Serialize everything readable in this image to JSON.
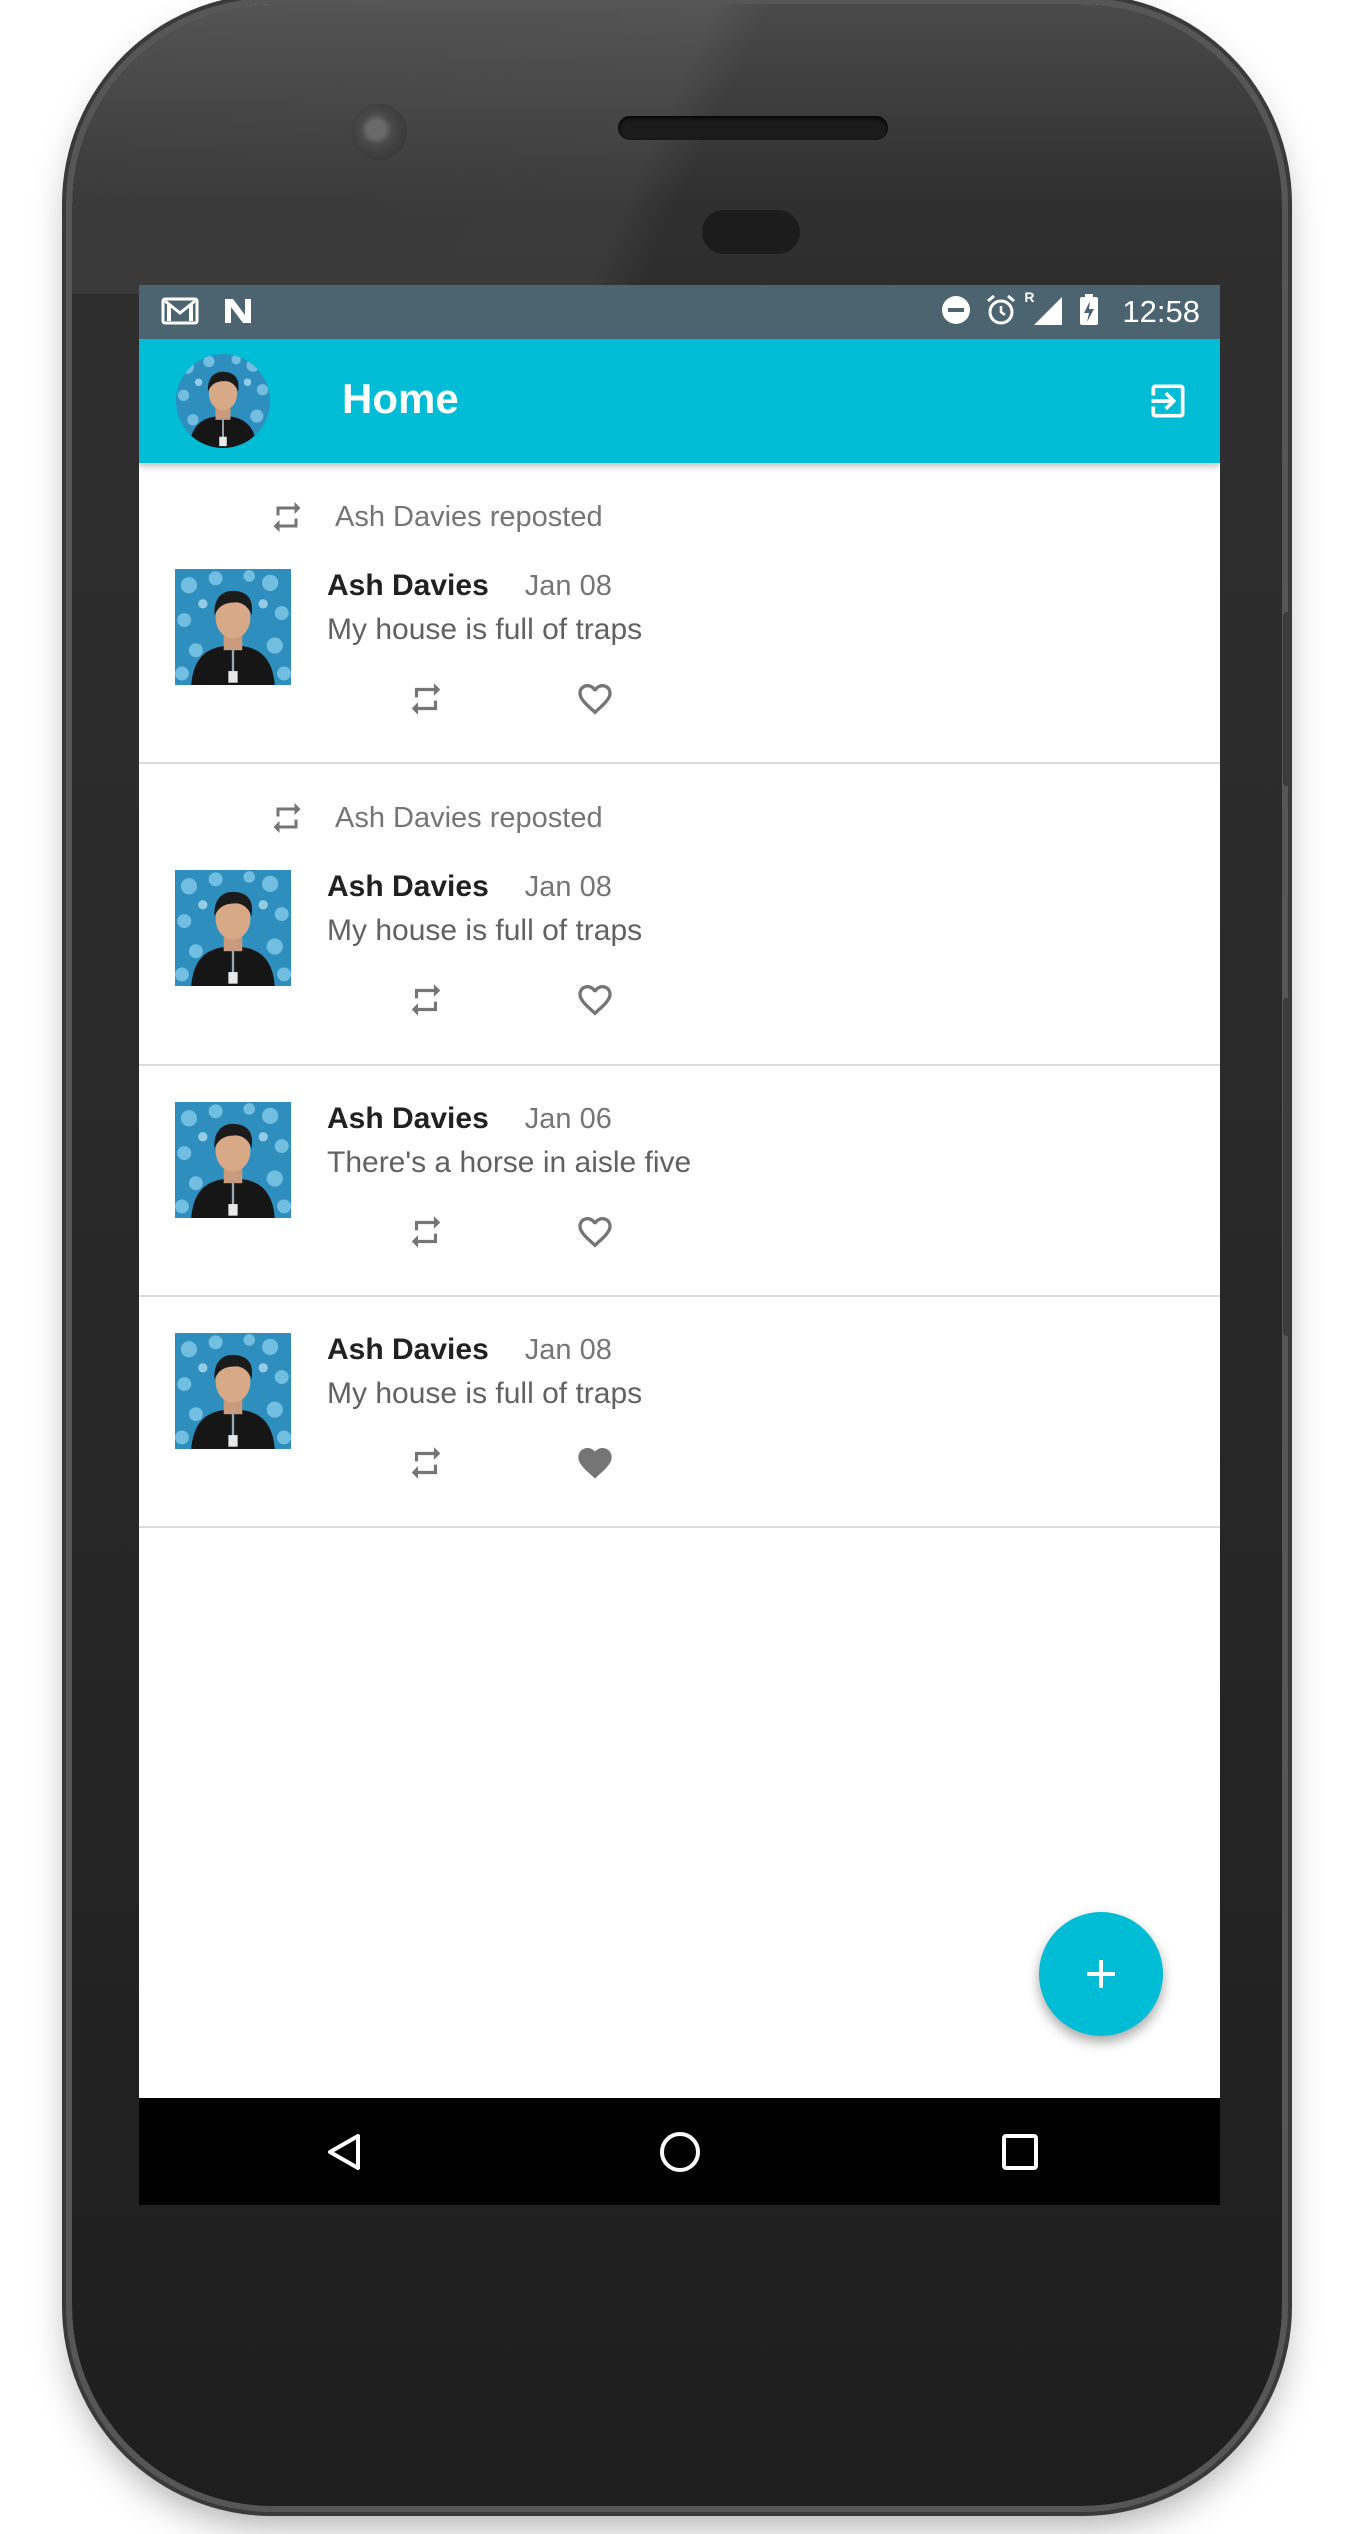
{
  "status_bar": {
    "time": "12:58",
    "left_icons": [
      "gmail-icon",
      "n-icon"
    ],
    "right_icons": [
      "do-not-disturb-icon",
      "alarm-icon",
      "signal-icon",
      "battery-charging-icon"
    ],
    "roaming_indicator": "R"
  },
  "app_bar": {
    "title": "Home",
    "action_icon": "logout-icon"
  },
  "posts": [
    {
      "repost_label": "Ash Davies reposted",
      "author": "Ash Davies",
      "date": "Jan 08",
      "text": "My house is full of traps",
      "liked": false
    },
    {
      "repost_label": "Ash Davies reposted",
      "author": "Ash Davies",
      "date": "Jan 08",
      "text": "My house is full of traps",
      "liked": false
    },
    {
      "author": "Ash Davies",
      "date": "Jan 06",
      "text": "There's a horse in aisle five",
      "liked": false
    },
    {
      "author": "Ash Davies",
      "date": "Jan 08",
      "text": "My house is full of traps",
      "liked": true
    }
  ],
  "fab": {
    "icon": "plus-icon"
  },
  "nav": {
    "icons": [
      "back-icon",
      "home-icon",
      "recents-icon"
    ]
  },
  "colors": {
    "app_bar": "#00bcd4",
    "status_bar": "#4c6470",
    "icon_grey": "#757575",
    "divider": "#dcdcdc"
  }
}
